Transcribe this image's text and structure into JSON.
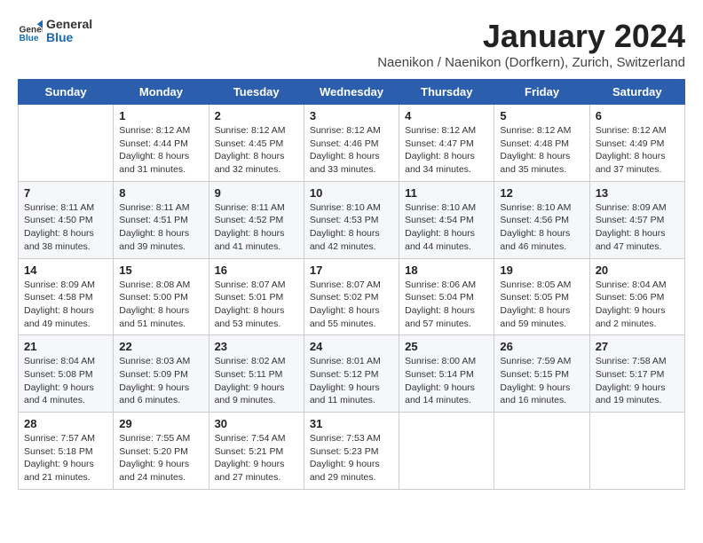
{
  "header": {
    "logo_general": "General",
    "logo_blue": "Blue",
    "title": "January 2024",
    "subtitle": "Naenikon / Naenikon (Dorfkern), Zurich, Switzerland"
  },
  "weekdays": [
    "Sunday",
    "Monday",
    "Tuesday",
    "Wednesday",
    "Thursday",
    "Friday",
    "Saturday"
  ],
  "weeks": [
    [
      {
        "day": "",
        "info": ""
      },
      {
        "day": "1",
        "info": "Sunrise: 8:12 AM\nSunset: 4:44 PM\nDaylight: 8 hours\nand 31 minutes."
      },
      {
        "day": "2",
        "info": "Sunrise: 8:12 AM\nSunset: 4:45 PM\nDaylight: 8 hours\nand 32 minutes."
      },
      {
        "day": "3",
        "info": "Sunrise: 8:12 AM\nSunset: 4:46 PM\nDaylight: 8 hours\nand 33 minutes."
      },
      {
        "day": "4",
        "info": "Sunrise: 8:12 AM\nSunset: 4:47 PM\nDaylight: 8 hours\nand 34 minutes."
      },
      {
        "day": "5",
        "info": "Sunrise: 8:12 AM\nSunset: 4:48 PM\nDaylight: 8 hours\nand 35 minutes."
      },
      {
        "day": "6",
        "info": "Sunrise: 8:12 AM\nSunset: 4:49 PM\nDaylight: 8 hours\nand 37 minutes."
      }
    ],
    [
      {
        "day": "7",
        "info": "Sunrise: 8:11 AM\nSunset: 4:50 PM\nDaylight: 8 hours\nand 38 minutes."
      },
      {
        "day": "8",
        "info": "Sunrise: 8:11 AM\nSunset: 4:51 PM\nDaylight: 8 hours\nand 39 minutes."
      },
      {
        "day": "9",
        "info": "Sunrise: 8:11 AM\nSunset: 4:52 PM\nDaylight: 8 hours\nand 41 minutes."
      },
      {
        "day": "10",
        "info": "Sunrise: 8:10 AM\nSunset: 4:53 PM\nDaylight: 8 hours\nand 42 minutes."
      },
      {
        "day": "11",
        "info": "Sunrise: 8:10 AM\nSunset: 4:54 PM\nDaylight: 8 hours\nand 44 minutes."
      },
      {
        "day": "12",
        "info": "Sunrise: 8:10 AM\nSunset: 4:56 PM\nDaylight: 8 hours\nand 46 minutes."
      },
      {
        "day": "13",
        "info": "Sunrise: 8:09 AM\nSunset: 4:57 PM\nDaylight: 8 hours\nand 47 minutes."
      }
    ],
    [
      {
        "day": "14",
        "info": "Sunrise: 8:09 AM\nSunset: 4:58 PM\nDaylight: 8 hours\nand 49 minutes."
      },
      {
        "day": "15",
        "info": "Sunrise: 8:08 AM\nSunset: 5:00 PM\nDaylight: 8 hours\nand 51 minutes."
      },
      {
        "day": "16",
        "info": "Sunrise: 8:07 AM\nSunset: 5:01 PM\nDaylight: 8 hours\nand 53 minutes."
      },
      {
        "day": "17",
        "info": "Sunrise: 8:07 AM\nSunset: 5:02 PM\nDaylight: 8 hours\nand 55 minutes."
      },
      {
        "day": "18",
        "info": "Sunrise: 8:06 AM\nSunset: 5:04 PM\nDaylight: 8 hours\nand 57 minutes."
      },
      {
        "day": "19",
        "info": "Sunrise: 8:05 AM\nSunset: 5:05 PM\nDaylight: 8 hours\nand 59 minutes."
      },
      {
        "day": "20",
        "info": "Sunrise: 8:04 AM\nSunset: 5:06 PM\nDaylight: 9 hours\nand 2 minutes."
      }
    ],
    [
      {
        "day": "21",
        "info": "Sunrise: 8:04 AM\nSunset: 5:08 PM\nDaylight: 9 hours\nand 4 minutes."
      },
      {
        "day": "22",
        "info": "Sunrise: 8:03 AM\nSunset: 5:09 PM\nDaylight: 9 hours\nand 6 minutes."
      },
      {
        "day": "23",
        "info": "Sunrise: 8:02 AM\nSunset: 5:11 PM\nDaylight: 9 hours\nand 9 minutes."
      },
      {
        "day": "24",
        "info": "Sunrise: 8:01 AM\nSunset: 5:12 PM\nDaylight: 9 hours\nand 11 minutes."
      },
      {
        "day": "25",
        "info": "Sunrise: 8:00 AM\nSunset: 5:14 PM\nDaylight: 9 hours\nand 14 minutes."
      },
      {
        "day": "26",
        "info": "Sunrise: 7:59 AM\nSunset: 5:15 PM\nDaylight: 9 hours\nand 16 minutes."
      },
      {
        "day": "27",
        "info": "Sunrise: 7:58 AM\nSunset: 5:17 PM\nDaylight: 9 hours\nand 19 minutes."
      }
    ],
    [
      {
        "day": "28",
        "info": "Sunrise: 7:57 AM\nSunset: 5:18 PM\nDaylight: 9 hours\nand 21 minutes."
      },
      {
        "day": "29",
        "info": "Sunrise: 7:55 AM\nSunset: 5:20 PM\nDaylight: 9 hours\nand 24 minutes."
      },
      {
        "day": "30",
        "info": "Sunrise: 7:54 AM\nSunset: 5:21 PM\nDaylight: 9 hours\nand 27 minutes."
      },
      {
        "day": "31",
        "info": "Sunrise: 7:53 AM\nSunset: 5:23 PM\nDaylight: 9 hours\nand 29 minutes."
      },
      {
        "day": "",
        "info": ""
      },
      {
        "day": "",
        "info": ""
      },
      {
        "day": "",
        "info": ""
      }
    ]
  ]
}
